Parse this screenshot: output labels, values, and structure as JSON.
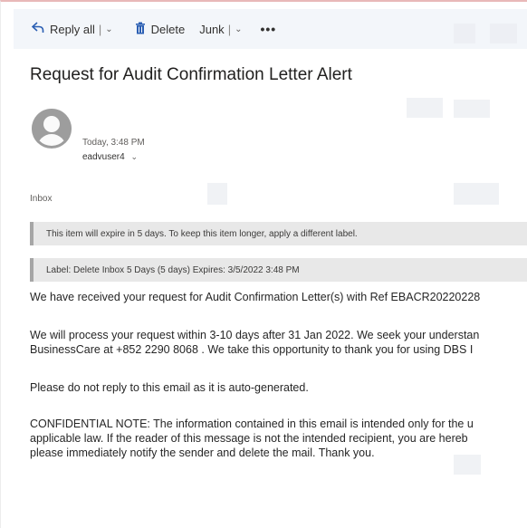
{
  "toolbar": {
    "reply_all_label": "Reply all",
    "delete_label": "Delete",
    "junk_label": "Junk",
    "more_label": "•••"
  },
  "message": {
    "subject": "Request for Audit Confirmation Letter Alert",
    "time": "Today, 3:48 PM",
    "sender": "eadvuser4",
    "folder": "Inbox",
    "retention_notice": "This item will expire in 5 days. To keep this item longer, apply a different label.",
    "label_notice": "Label: Delete Inbox 5 Days (5 days) Expires: 3/5/2022 3:48 PM",
    "body": {
      "p1": "We have received your request for Audit Confirmation Letter(s) with Ref EBACR20220228",
      "p2_line1": "We will process your request within 3-10 days after 31 Jan 2022. We seek your understan",
      "p2_line2": "BusinessCare at +852 2290 8068 . We take this opportunity to thank you for using DBS I",
      "p3": "Please do not reply to this email as it is auto-generated.",
      "p4_line1": "CONFIDENTIAL NOTE: The information contained in this email is intended only for the u",
      "p4_line2": "applicable law. If the reader of this message is not the intended recipient, you are hereb",
      "p4_line3": "please immediately notify the sender and delete the mail. Thank you."
    }
  },
  "colors": {
    "toolbar_bg": "#f3f6fa",
    "accent": "#2b5fb3",
    "notice_bg": "#e8e8e8",
    "avatar": "#9d9d9d"
  },
  "icons": {
    "reply_all": "reply-all-icon",
    "delete": "trash-icon",
    "more": "more-icon"
  }
}
